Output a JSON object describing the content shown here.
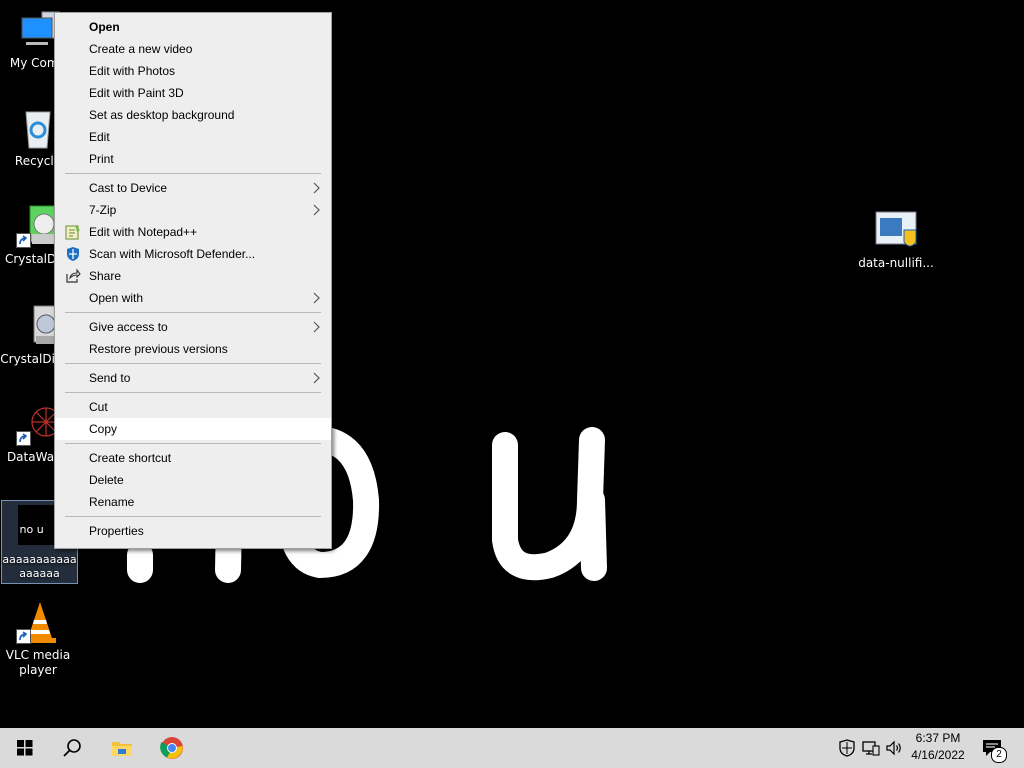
{
  "wallpaper": {
    "text": "no u"
  },
  "desktop": {
    "icons": [
      {
        "label": "My Comp",
        "icon": "computer-icon"
      },
      {
        "label": "Recycle",
        "icon": "recycle-bin-icon"
      },
      {
        "label": "CrystalDi 8",
        "icon": "crystaldisk-icon"
      },
      {
        "label": "CrystalDi (1)",
        "icon": "crystaldisk-info-icon"
      },
      {
        "label": "DataWage",
        "icon": "datawage-icon"
      },
      {
        "label": "aaaaaaaaaaaaaaaaa",
        "thumb_text": "no u",
        "icon": "image-file-icon"
      },
      {
        "label": "VLC media player",
        "icon": "vlc-icon"
      },
      {
        "label": "data-nullifi...",
        "icon": "installer-icon"
      }
    ]
  },
  "context_menu": {
    "items": [
      {
        "label": "Open"
      },
      {
        "label": "Create a new video"
      },
      {
        "label": "Edit with Photos"
      },
      {
        "label": "Edit with Paint 3D"
      },
      {
        "label": "Set as desktop background"
      },
      {
        "label": "Edit"
      },
      {
        "label": "Print"
      },
      {
        "label": "Cast to Device"
      },
      {
        "label": "7-Zip"
      },
      {
        "label": "Edit with Notepad++"
      },
      {
        "label": "Scan with Microsoft Defender..."
      },
      {
        "label": "Share"
      },
      {
        "label": "Open with"
      },
      {
        "label": "Give access to"
      },
      {
        "label": "Restore previous versions"
      },
      {
        "label": "Send to"
      },
      {
        "label": "Cut"
      },
      {
        "label": "Copy"
      },
      {
        "label": "Create shortcut"
      },
      {
        "label": "Delete"
      },
      {
        "label": "Rename"
      },
      {
        "label": "Properties"
      }
    ]
  },
  "taskbar": {
    "clock_time": "6:37 PM",
    "clock_date": "4/16/2022",
    "notification_count": "2"
  }
}
